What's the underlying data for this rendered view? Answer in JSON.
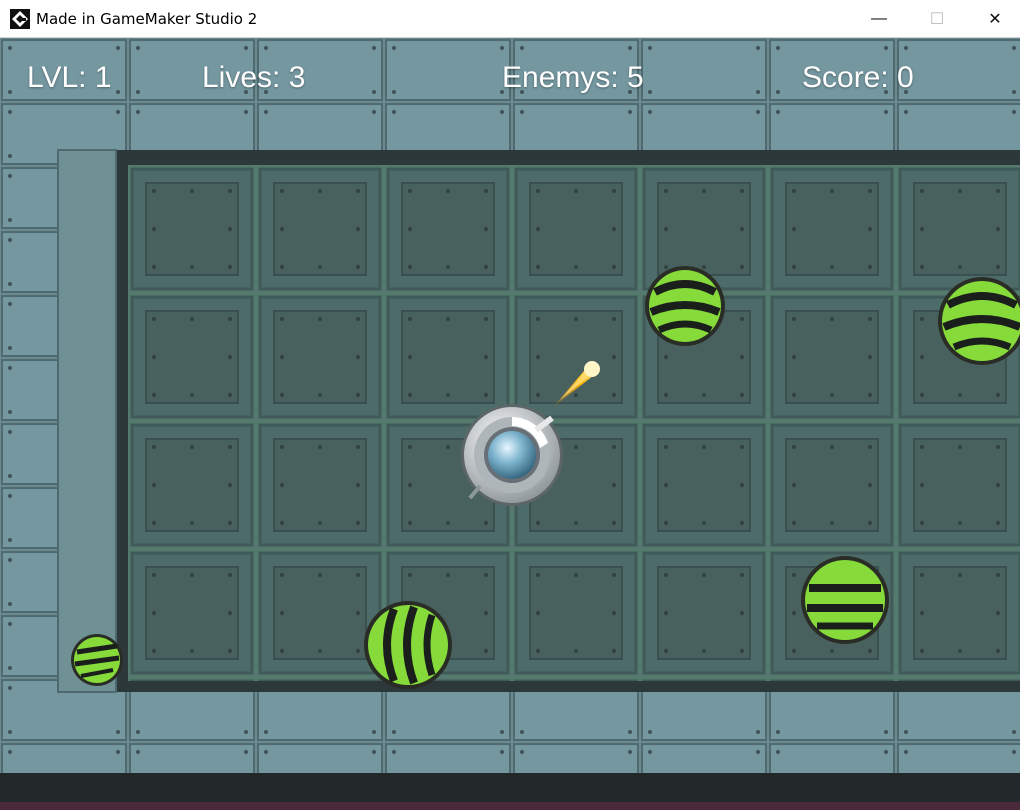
{
  "window": {
    "title": "Made in GameMaker Studio 2",
    "minimize_glyph": "—",
    "maximize_glyph": "☐",
    "close_glyph": "✕"
  },
  "hud": {
    "level": "LVL: 1",
    "lives": "Lives: 3",
    "enemies": "Enemys: 5",
    "score": "Score: 0"
  },
  "colors": {
    "floor": "#4e6a6c",
    "wall": "#6f9095",
    "enemy_green": "#7fd33a",
    "enemy_stripe": "#1b1f1c",
    "bullet": "#ffd24a"
  },
  "sprites": {
    "player": "player-turret-icon",
    "enemy": "spiky-ball-icon",
    "projectile": "fireball-icon"
  }
}
